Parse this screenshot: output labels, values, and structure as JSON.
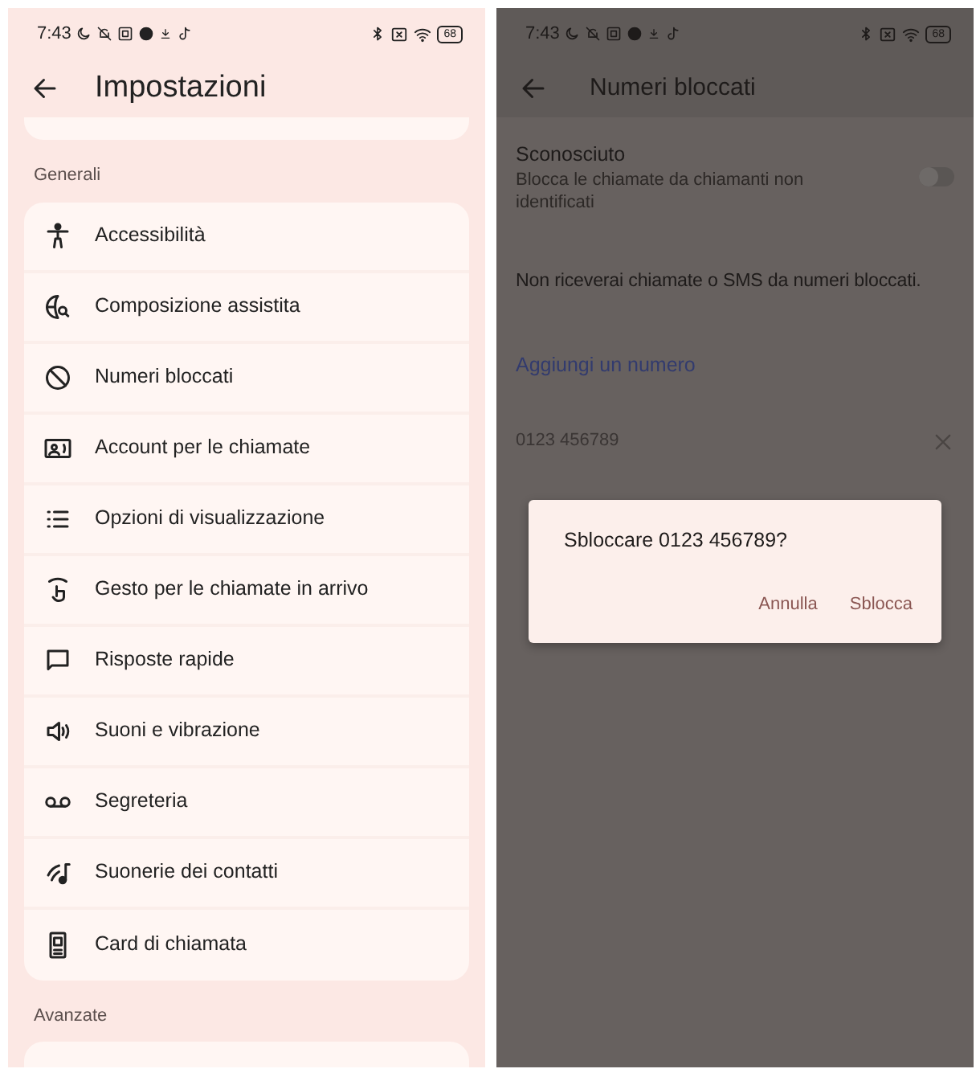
{
  "screens": [
    {
      "status_bar": {
        "time": "7:43",
        "battery": "68"
      },
      "title": "Impostazioni",
      "sections": [
        {
          "heading": "Generali",
          "items": [
            "Accessibilità",
            "Composizione assistita",
            "Numeri bloccati",
            "Account per le chiamate",
            "Opzioni di visualizzazione",
            "Gesto per le chiamate in arrivo",
            "Risposte rapide",
            "Suoni e vibrazione",
            "Segreteria",
            "Suonerie dei contatti",
            "Card di chiamata"
          ]
        },
        {
          "heading": "Avanzate"
        }
      ]
    },
    {
      "status_bar": {
        "time": "7:43",
        "battery": "68"
      },
      "title": "Numeri bloccati",
      "setting": {
        "label": "Sconosciuto",
        "description": "Blocca le chiamate da chiamanti non identificati",
        "on": false
      },
      "info": "Non riceverai chiamate o SMS da numeri bloccati.",
      "add_link": "Aggiungi un numero",
      "blocked_numbers": [
        "0123 456789"
      ],
      "dialog": {
        "message": "Sbloccare 0123 456789?",
        "buttons": [
          "Annulla",
          "Sblocca"
        ]
      }
    }
  ]
}
